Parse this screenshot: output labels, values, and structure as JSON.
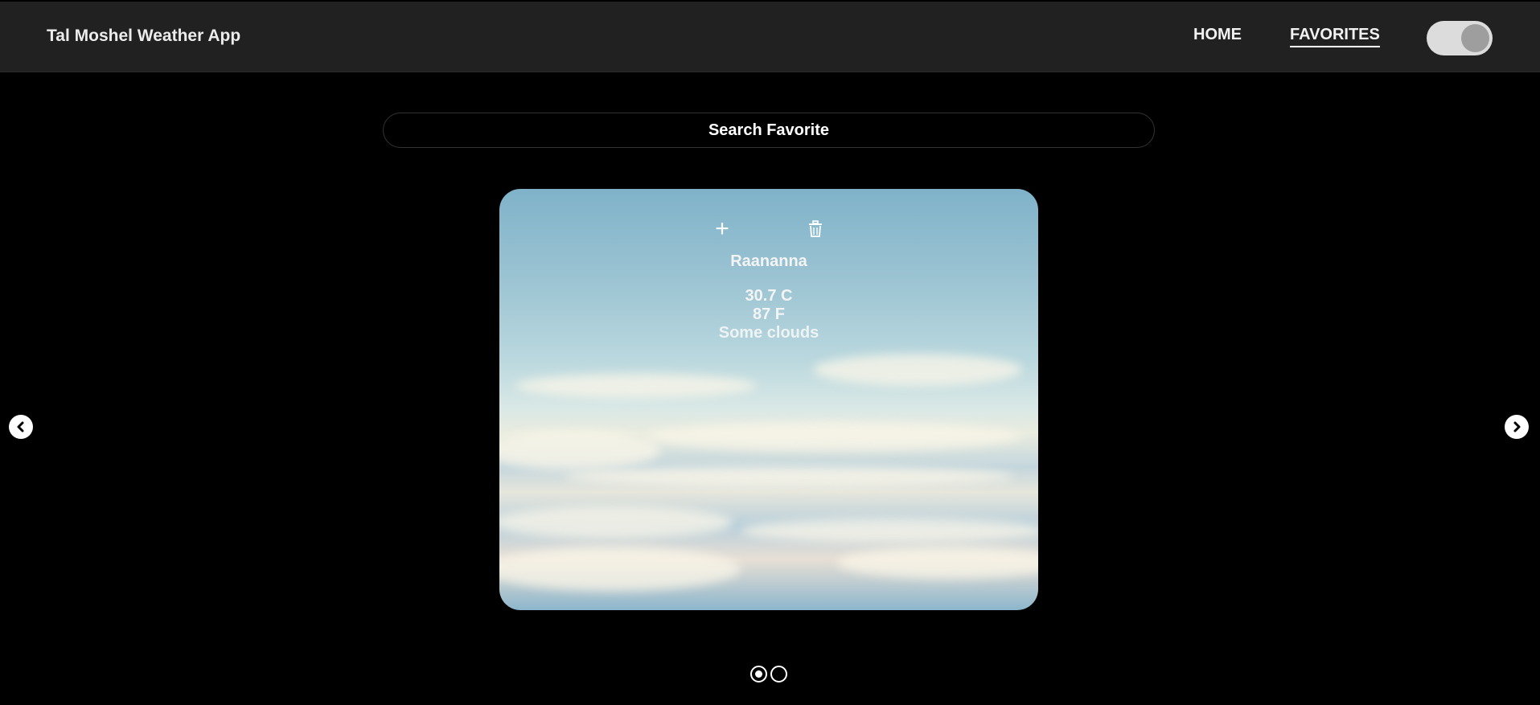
{
  "header": {
    "title": "Tal Moshel Weather App",
    "nav": {
      "home": "HOME",
      "favorites": "FAVORITES"
    },
    "theme_toggle": {
      "icon": "toggle-switch",
      "state": "on"
    }
  },
  "search": {
    "placeholder": "Search Favorite",
    "value": ""
  },
  "carousel": {
    "card": {
      "city": "Raananna",
      "temp_c": "30.7 C",
      "temp_f": "87 F",
      "condition": "Some clouds",
      "actions": {
        "add_icon": "plus-icon",
        "delete_icon": "trash-icon"
      }
    },
    "prev_icon": "chevron-left-icon",
    "next_icon": "chevron-right-icon",
    "pages": 2,
    "active_page": 1
  },
  "colors": {
    "header_bg": "#212121",
    "page_bg": "#000000",
    "toggle_track": "#dcdcdc",
    "toggle_knob": "#9e9e9e"
  }
}
